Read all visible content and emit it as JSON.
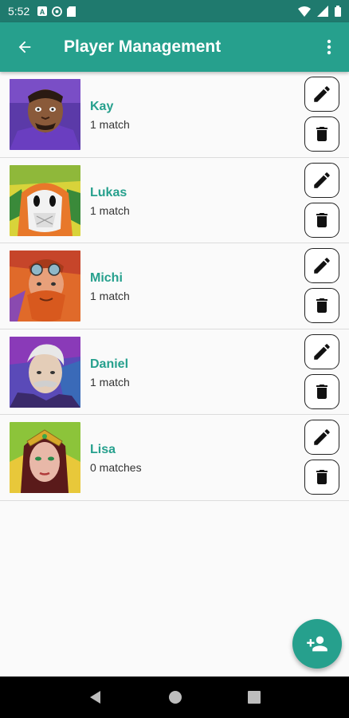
{
  "status_bar": {
    "time": "5:52"
  },
  "app_bar": {
    "title": "Player Management"
  },
  "players": [
    {
      "name": "Kay",
      "matches": "1 match"
    },
    {
      "name": "Lukas",
      "matches": "1 match"
    },
    {
      "name": "Michi",
      "matches": "1 match"
    },
    {
      "name": "Daniel",
      "matches": "1 match"
    },
    {
      "name": "Lisa",
      "matches": "0 matches"
    }
  ],
  "colors": {
    "accent": "#26a08d",
    "status_bar": "#1f7a6e"
  },
  "icons": {
    "back": "arrow-left-icon",
    "menu": "more-vert-icon",
    "edit": "pencil-icon",
    "delete": "trash-icon",
    "fab": "add-person-icon"
  }
}
